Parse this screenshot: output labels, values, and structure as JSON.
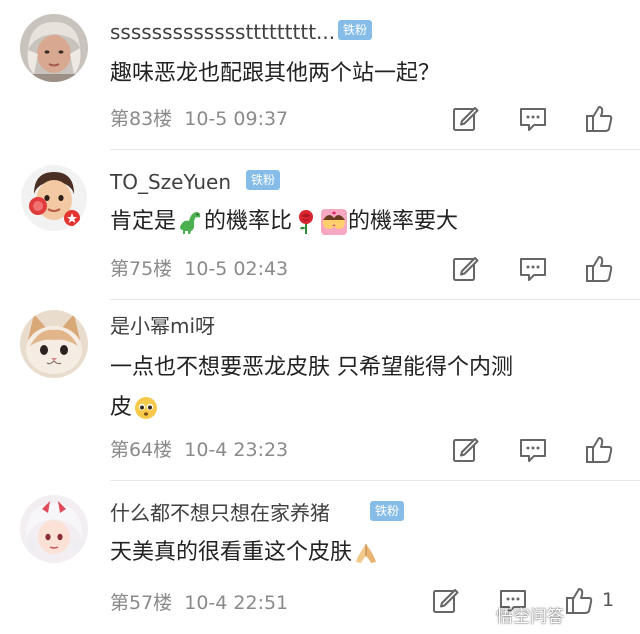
{
  "comments": [
    {
      "username": "sssssssssssssttttttttt...",
      "badge": "铁粉",
      "text": [
        "趣味恶龙也配跟其他两个站一起？"
      ],
      "floor": "第83楼",
      "time": "10-5 09:37",
      "likes": ""
    },
    {
      "username": "TO_SzeYuen",
      "badge": "铁粉",
      "text_parts": [
        "肯定是",
        "的機率比",
        "的機率要大"
      ],
      "floor": "第75楼",
      "time": "10-5 02:43",
      "likes": ""
    },
    {
      "username": "是小幂mi呀",
      "text": [
        "一点也不想要恶龙皮肤  只希望能得个内测",
        "皮"
      ],
      "floor": "第64楼",
      "time": "10-4 23:23",
      "likes": ""
    },
    {
      "username": "什么都不想只想在家养猪",
      "badge": "铁粉",
      "text": [
        "天美真的很看重这个皮肤"
      ],
      "floor": "第57楼",
      "time": "10-4 22:51",
      "likes": "1"
    }
  ],
  "watermark": {
    "text": "悟空问答"
  },
  "icons": {
    "edit": "edit-icon",
    "comment": "comment-icon",
    "like": "thumbs-up-icon"
  },
  "colors": {
    "badge": "#86bde8",
    "username": "#404040",
    "meta": "#8a8a8a",
    "text": "#222222"
  }
}
